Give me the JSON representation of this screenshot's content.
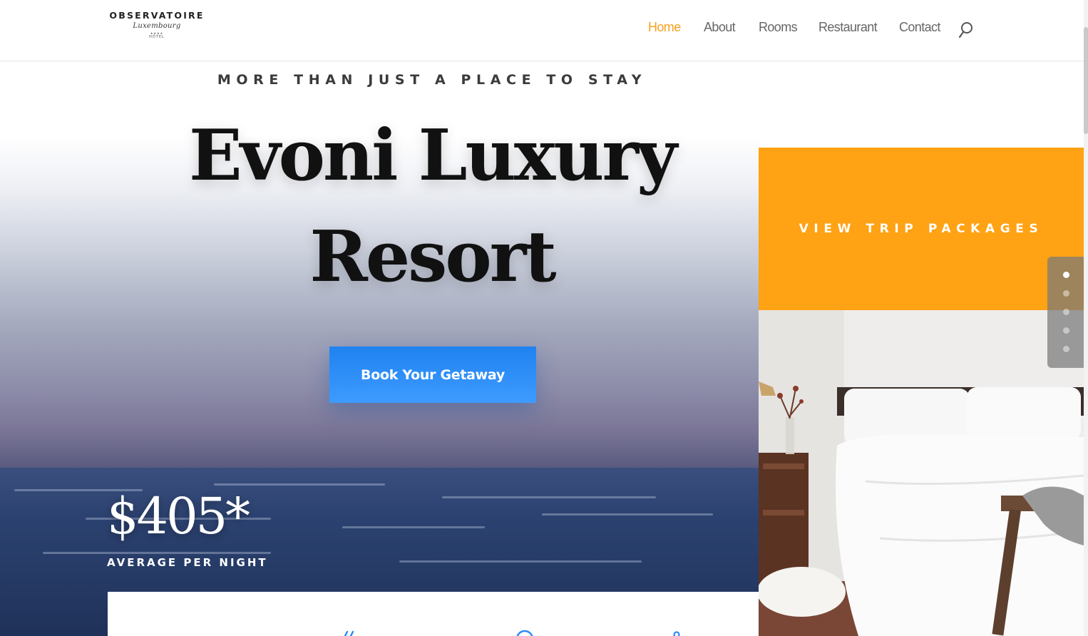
{
  "header": {
    "logo": {
      "wordmark": "OBSERVATOIRE",
      "script": "Luxembourg",
      "stars": "★★★★",
      "subtitle": "HÔTEL"
    },
    "nav": [
      {
        "label": "Home",
        "active": true
      },
      {
        "label": "About",
        "active": false
      },
      {
        "label": "Rooms",
        "active": false
      },
      {
        "label": "Restaurant",
        "active": false
      },
      {
        "label": "Contact",
        "active": false
      }
    ],
    "search_icon": "search-icon"
  },
  "hero": {
    "tagline": "MORE THAN JUST A PLACE TO STAY",
    "title_line1": "Evoni Luxury",
    "title_line2": "Resort",
    "book_label": "Book Your Getaway",
    "price": "$405*",
    "price_caption": "AVERAGE PER NIGHT"
  },
  "side": {
    "trip_label": "VIEW TRIP PACKAGES",
    "slides": 5,
    "active_slide": 0
  },
  "colors": {
    "accent": "#f5a11d",
    "trip_bg": "#ffa213",
    "button_blue": "#2b8cf7",
    "nav_text": "#666666"
  }
}
